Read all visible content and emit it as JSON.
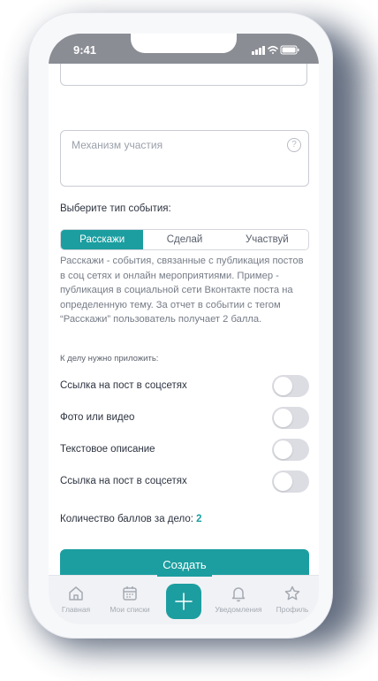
{
  "status_bar": {
    "time": "9:41"
  },
  "form": {
    "mechanism_placeholder": "Механизм участия",
    "help_glyph": "?",
    "event_type_label": "Выберите тип события:",
    "event_types": [
      "Расскажи",
      "Сделай",
      "Участвуй"
    ],
    "selected_event_type": "Расскажи",
    "description": "Расскажи - события, связанные с публикация постов в соц сетях и онлайн мероприятиями. Пример - публикация в социальной сети Вконтакте поста на определенную тему. За отчет в событии с тегом “Расскажи” пользователь получает 2 балла.",
    "attach_label": "К делу нужно приложить:",
    "attachments": [
      {
        "label": "Ссылка на пост в соцсетях",
        "enabled": false
      },
      {
        "label": "Фото или видео",
        "enabled": false
      },
      {
        "label": "Текстовое описание",
        "enabled": false
      },
      {
        "label": "Ссылка на пост в соцсетях",
        "enabled": false
      }
    ],
    "points_label": "Количество баллов за дело:",
    "points_value": "2",
    "create_button": "Создать"
  },
  "tabbar": {
    "items": [
      {
        "label": "Главная",
        "icon": "home-icon"
      },
      {
        "label": "Мои списки",
        "icon": "calendar-icon"
      },
      {
        "label": "",
        "icon": "plus-icon"
      },
      {
        "label": "Уведомления",
        "icon": "bell-icon"
      },
      {
        "label": "Профиль",
        "icon": "star-icon"
      }
    ]
  },
  "colors": {
    "accent": "#1c9ea0",
    "statusbar": "#8a8d94",
    "toggle_off": "#dcdde3"
  }
}
